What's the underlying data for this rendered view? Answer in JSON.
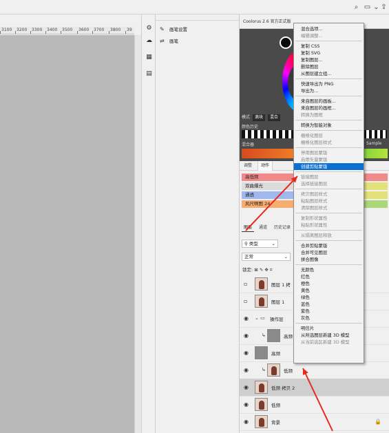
{
  "ruler": {
    "ticks": [
      "3100",
      "3200",
      "3300",
      "3400",
      "3500",
      "3600",
      "3700",
      "3800",
      "39"
    ]
  },
  "brush_panel": {
    "rows": [
      "画笔设置",
      "画笔"
    ]
  },
  "coolorus": {
    "title": "Coolorus 2.6 官方正式版",
    "mode_label": "模式",
    "mode_btn1": "滴块",
    "mode_btn2": "混合",
    "history_label": "颜色历史",
    "mixer_label": "混合器",
    "sample_label": "Sample"
  },
  "actions_panel": {
    "tabs": [
      "调整",
      "动作"
    ],
    "items": [
      {
        "label": "高低频",
        "color": "#f08a8a"
      },
      {
        "label": "双曲爆光",
        "color": "#dcdcdc"
      },
      {
        "label": "通透",
        "color": "#9fb8ef"
      },
      {
        "label": "风尺啊图 24",
        "color": "#f6ad6f"
      }
    ],
    "right_colors": [
      "#f08a8a",
      "#e4e07a",
      "#e4e07a",
      "#a9d77a"
    ]
  },
  "layers_panel": {
    "tabs": [
      "图层",
      "通道",
      "历史记录"
    ],
    "filter": "类型",
    "blend_mode": "正常",
    "lock_label": "锁定:",
    "layers": [
      {
        "name": "图层 1 拷",
        "selected": false,
        "eye": false,
        "thumb": "photo",
        "clip": false,
        "group": false,
        "lock": false
      },
      {
        "name": "图层 1",
        "selected": false,
        "eye": false,
        "thumb": "photo",
        "clip": false,
        "group": false,
        "lock": false
      },
      {
        "name": "操作层",
        "selected": false,
        "eye": true,
        "thumb": "none",
        "clip": false,
        "group": true,
        "lock": false
      },
      {
        "name": "高频",
        "selected": false,
        "eye": true,
        "thumb": "gray",
        "clip": true,
        "group": false,
        "lock": false
      },
      {
        "name": "高频",
        "selected": false,
        "eye": true,
        "thumb": "gray",
        "clip": false,
        "group": false,
        "lock": false
      },
      {
        "name": "低频",
        "selected": false,
        "eye": true,
        "thumb": "photo",
        "clip": true,
        "group": false,
        "lock": false
      },
      {
        "name": "低频 拷贝 2",
        "selected": true,
        "eye": true,
        "thumb": "photo",
        "clip": false,
        "group": false,
        "lock": false
      },
      {
        "name": "低频",
        "selected": false,
        "eye": true,
        "thumb": "photo",
        "clip": false,
        "group": false,
        "lock": false
      },
      {
        "name": "背景",
        "selected": false,
        "eye": true,
        "thumb": "photo",
        "clip": false,
        "group": false,
        "lock": true
      }
    ]
  },
  "context_menu": {
    "items": [
      {
        "label": "混合选项...",
        "state": "normal"
      },
      {
        "label": "编辑调整...",
        "state": "disabled"
      },
      {
        "sep": true
      },
      {
        "label": "复制 CSS",
        "state": "normal"
      },
      {
        "label": "复制 SVG",
        "state": "normal"
      },
      {
        "label": "复制图层...",
        "state": "normal"
      },
      {
        "label": "删除图层",
        "state": "normal"
      },
      {
        "label": "从图层建立组...",
        "state": "normal"
      },
      {
        "sep": true
      },
      {
        "label": "快速导出为 PNG",
        "state": "normal"
      },
      {
        "label": "导出为...",
        "state": "normal"
      },
      {
        "sep": true
      },
      {
        "label": "来自图层的画板...",
        "state": "normal"
      },
      {
        "label": "来自图层的画框...",
        "state": "normal"
      },
      {
        "label": "转换为图框",
        "state": "disabled"
      },
      {
        "sep": true
      },
      {
        "label": "转换为智能对象",
        "state": "normal"
      },
      {
        "sep": true
      },
      {
        "label": "栅格化图层",
        "state": "disabled"
      },
      {
        "label": "栅格化图层样式",
        "state": "disabled"
      },
      {
        "sep": true
      },
      {
        "label": "停用图层蒙版",
        "state": "disabled"
      },
      {
        "label": "启用矢量蒙版",
        "state": "disabled"
      },
      {
        "label": "创建剪贴蒙版",
        "state": "highlighted"
      },
      {
        "sep": true
      },
      {
        "label": "链接图层",
        "state": "disabled"
      },
      {
        "label": "选择链接图层",
        "state": "disabled"
      },
      {
        "sep": true
      },
      {
        "label": "拷贝图层样式",
        "state": "disabled"
      },
      {
        "label": "粘贴图层样式",
        "state": "disabled"
      },
      {
        "label": "清除图层样式",
        "state": "disabled"
      },
      {
        "sep": true
      },
      {
        "label": "复制形状属性",
        "state": "disabled"
      },
      {
        "label": "粘贴形状属性",
        "state": "disabled"
      },
      {
        "sep": true
      },
      {
        "label": "从隔离图层释放",
        "state": "disabled"
      },
      {
        "sep": true
      },
      {
        "label": "合并剪贴蒙版",
        "state": "normal"
      },
      {
        "label": "合并可见图层",
        "state": "normal"
      },
      {
        "label": "拼合图像",
        "state": "normal"
      },
      {
        "sep": true
      },
      {
        "label": "无颜色",
        "state": "normal"
      },
      {
        "label": "红色",
        "state": "normal"
      },
      {
        "label": "橙色",
        "state": "normal"
      },
      {
        "label": "黄色",
        "state": "normal"
      },
      {
        "label": "绿色",
        "state": "normal"
      },
      {
        "label": "蓝色",
        "state": "normal"
      },
      {
        "label": "紫色",
        "state": "normal"
      },
      {
        "label": "灰色",
        "state": "normal"
      },
      {
        "sep": true
      },
      {
        "label": "明信片",
        "state": "normal"
      },
      {
        "label": "从所选图层新建 3D 模型",
        "state": "normal"
      },
      {
        "label": "从当前选区新建 3D 模型",
        "state": "disabled"
      }
    ]
  },
  "annotation_color": "#e8281c"
}
